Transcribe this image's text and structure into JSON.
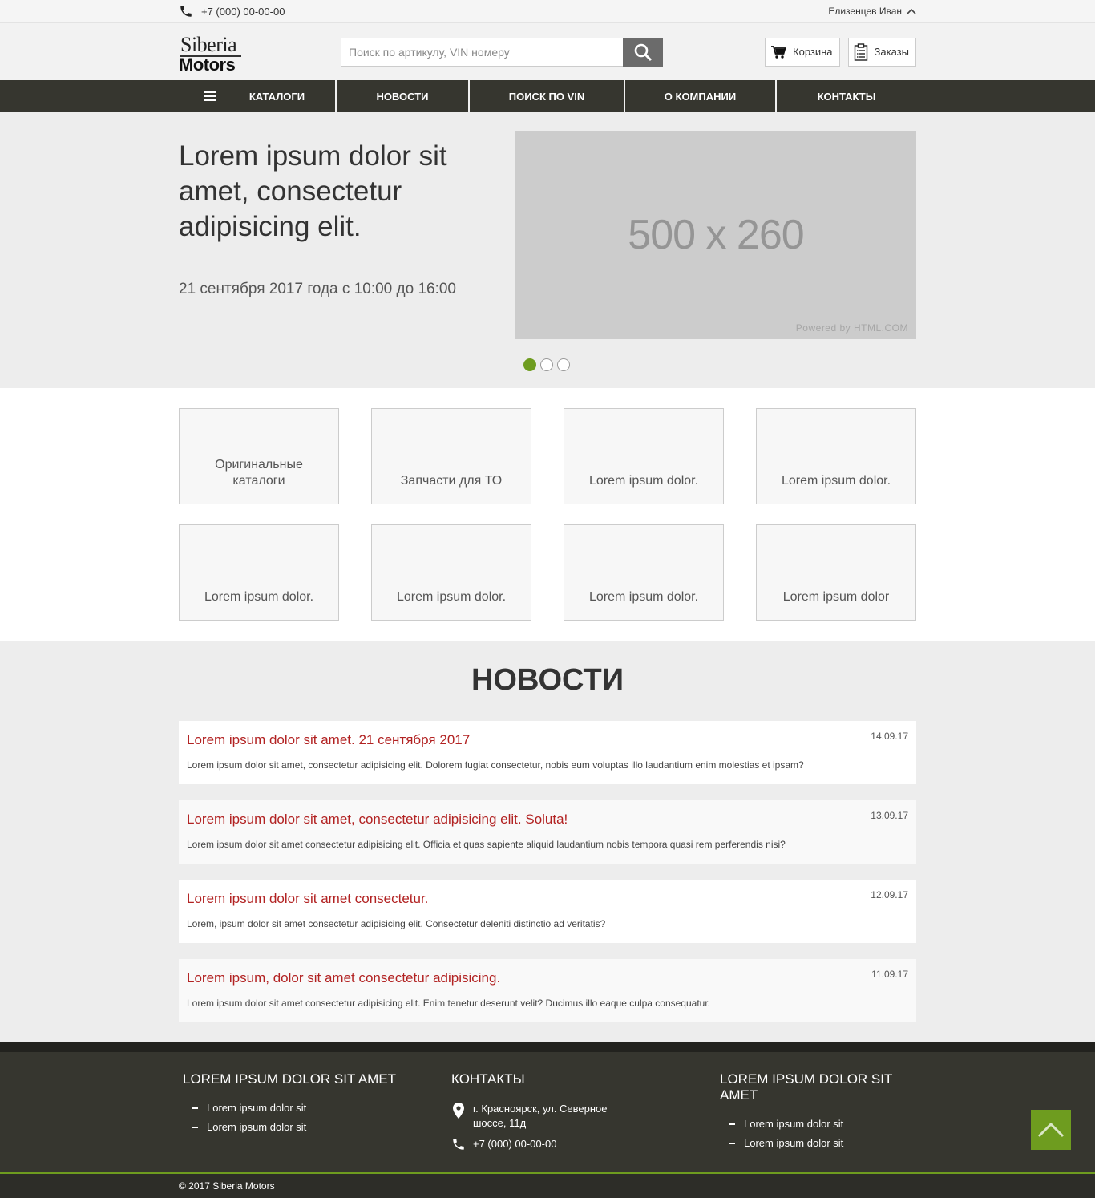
{
  "topbar": {
    "phone": "+7 (000) 00-00-00",
    "user": "Елизенцев Иван"
  },
  "header": {
    "logo_line1": "Siberia",
    "logo_line2": "Motors",
    "search_placeholder": "Поиск по артикулу, VIN номеру",
    "cart_label": "Корзина",
    "orders_label": "Заказы"
  },
  "nav": [
    "КАТАЛОГИ",
    "НОВОСТИ",
    "ПОИСК ПО VIN",
    "О КОМПАНИИ",
    "КОНТАКТЫ"
  ],
  "hero": {
    "title": "Lorem ipsum dolor sit amet, consectetur adipisicing elit.",
    "date": "21 сентября 2017 года с 10:00 до 16:00",
    "placeholder_size": "500 x 260",
    "placeholder_credit": "Powered by HTML.COM",
    "slides_count": 3,
    "active_slide": 1
  },
  "tiles": [
    "Оригинальные каталоги",
    "Запчасти для ТО",
    "Lorem ipsum dolor.",
    "Lorem ipsum dolor.",
    "Lorem ipsum dolor.",
    "Lorem ipsum dolor.",
    "Lorem ipsum dolor.",
    "Lorem ipsum dolor"
  ],
  "news": {
    "heading": "НОВОСТИ",
    "items": [
      {
        "title": "Lorem ipsum dolor sit amet. 21 сентября 2017",
        "date": "14.09.17",
        "text": "Lorem ipsum dolor sit amet, consectetur adipisicing elit. Dolorem fugiat consectetur, nobis eum voluptas illo laudantium enim molestias et ipsam?"
      },
      {
        "title": "Lorem ipsum dolor sit amet, consectetur adipisicing elit. Soluta!",
        "date": "13.09.17",
        "text": "Lorem ipsum dolor sit amet consectetur adipisicing elit. Officia et quas sapiente aliquid laudantium nobis tempora quasi rem perferendis nisi?"
      },
      {
        "title": "Lorem ipsum dolor sit amet consectetur.",
        "date": "12.09.17",
        "text": "Lorem, ipsum dolor sit amet consectetur adipisicing elit. Consectetur deleniti distinctio ad veritatis?"
      },
      {
        "title": "Lorem ipsum, dolor sit amet consectetur adipisicing.",
        "date": "11.09.17",
        "text": "Lorem ipsum dolor sit amet consectetur adipisicing elit. Enim tenetur deserunt velit? Ducimus illo eaque culpa consequatur."
      }
    ]
  },
  "footer": {
    "col1": {
      "title": "LOREM IPSUM DOLOR SIT AMET",
      "links": [
        "Lorem ipsum dolor sit",
        "Lorem ipsum dolor sit"
      ]
    },
    "col2": {
      "title": "КОНТАКТЫ",
      "address": "г. Красноярск, ул. Северное шоссе, 11д",
      "phone": "+7 (000) 00-00-00"
    },
    "col3": {
      "title": "LOREM IPSUM DOLOR SIT AMET",
      "links": [
        "Lorem ipsum dolor sit",
        "Lorem ipsum dolor sit"
      ]
    },
    "copyright": "© 2017 Siberia Motors"
  },
  "colors": {
    "accent": "#6e9c1f",
    "nav_bg": "#36362f",
    "news_title": "#b22222"
  }
}
